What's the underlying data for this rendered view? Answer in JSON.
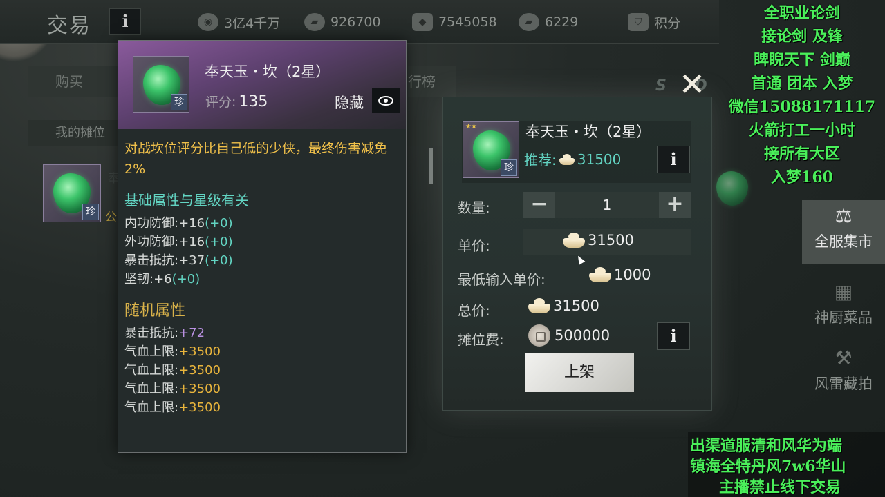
{
  "topbar": {
    "title": "交易",
    "info_icon": "i",
    "currencies": [
      {
        "icon": "coin-icon",
        "value": "3亿4千万"
      },
      {
        "icon": "ingot-icon",
        "value": "926700"
      },
      {
        "icon": "ticket-icon",
        "value": "7545058"
      },
      {
        "icon": "ingot-icon",
        "value": "6229"
      },
      {
        "icon": "points-icon",
        "value": "积分"
      }
    ]
  },
  "background": {
    "tab_buy": "购买",
    "tab_rank": "行榜",
    "stall_header": "我的摊位",
    "stall_item_short": "奉",
    "stall_item_tag": "公"
  },
  "side_menu": {
    "items": [
      {
        "label": "全服集市",
        "icon": "scale-icon",
        "active": true
      },
      {
        "label": "神厨菜品",
        "icon": "cookware-icon",
        "active": false
      },
      {
        "label": "风雷藏拍",
        "icon": "gavel-icon",
        "active": false
      }
    ],
    "partial_label": "集市"
  },
  "tooltip": {
    "name": "奉天玉・坎（2星）",
    "rarity": "珍",
    "score_label": "评分:",
    "score": "135",
    "hide_label": "隐藏",
    "description": "对战坎位评分比自己低的少侠，最终伤害减免2%",
    "base_section": "基础属性与星级有关",
    "base_attrs": [
      {
        "name": "内功防御:",
        "value": "+16",
        "bonus": "(+0)"
      },
      {
        "name": "外功防御:",
        "value": "+16",
        "bonus": "(+0)"
      },
      {
        "name": "暴击抵抗:",
        "value": "+37",
        "bonus": "(+0)"
      },
      {
        "name": "坚韧:",
        "value": "+6",
        "bonus": "(+0)"
      }
    ],
    "random_section": "随机属性",
    "random_attrs": [
      {
        "name": "暴击抵抗:",
        "value": "+72"
      },
      {
        "name": "气血上限:",
        "value": "+3500"
      },
      {
        "name": "气血上限:",
        "value": "+3500"
      },
      {
        "name": "气血上限:",
        "value": "+3500"
      },
      {
        "name": "气血上限:",
        "value": "+3500"
      }
    ]
  },
  "dialog": {
    "item_name": "奉天玉・坎（2星）",
    "rarity": "珍",
    "stars": "★★",
    "recommend_label": "推荐:",
    "recommend_price": "31500",
    "quantity_label": "数量:",
    "quantity": "1",
    "minus": "−",
    "plus": "+",
    "unit_price_label": "单价:",
    "unit_price": "31500",
    "min_price_label": "最低输入单价:",
    "min_price": "1000",
    "total_label": "总价:",
    "total": "31500",
    "fee_label": "摊位费:",
    "fee": "500000",
    "list_button": "上架",
    "close": "✕"
  },
  "overlay": {
    "top_lines": [
      "全职业论剑",
      "接论剑 及锋",
      "睥睨天下  剑巅",
      "首通 团本 入梦",
      "微信15088171117",
      "火箭打工一小时",
      "接所有大区",
      "入梦160"
    ],
    "bottom_lines": [
      "出渠道服清和风华为端",
      "镇海全特丹风7w6华山",
      "主播禁止线下交易"
    ]
  },
  "colors": {
    "accent_teal": "#62d4c2",
    "desc_gold": "#f0c04a",
    "overlay_green": "#4af05a",
    "rarity_purple": "#8a5a9c"
  }
}
